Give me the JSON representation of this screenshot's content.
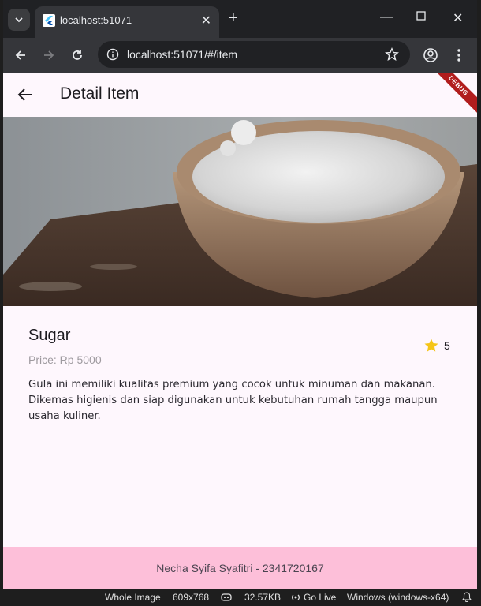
{
  "browser": {
    "tab_title": "localhost:51071",
    "url": "localhost:51071/#/item"
  },
  "app": {
    "title": "Detail Item",
    "debug_label": "DEBUG"
  },
  "product": {
    "name": "Sugar",
    "price": "Price: Rp 5000",
    "rating": "5",
    "description": "Gula ini memiliki kualitas premium yang cocok untuk minuman dan makanan. Dikemas higienis dan siap digunakan untuk kebutuhan rumah tangga maupun usaha kuliner."
  },
  "footer": {
    "text": "Necha Syifa Syafitri - 2341720167"
  },
  "statusbar": {
    "view": "Whole Image",
    "dimensions": "609x768",
    "size": "32.57KB",
    "golive": "Go Live",
    "platform": "Windows (windows-x64)"
  },
  "colors": {
    "app_background": "#fef7fd",
    "footer_background": "#fdbfd9",
    "star": "#f5c518",
    "debug_ribbon": "#b11d1d"
  }
}
